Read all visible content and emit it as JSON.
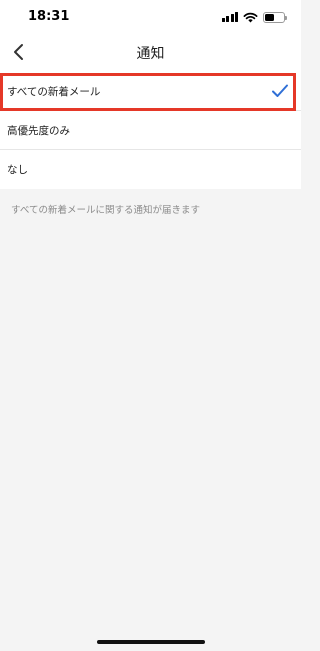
{
  "status_bar": {
    "time": "18:31",
    "battery_level": 0.45
  },
  "nav": {
    "title": "通知",
    "back_icon": "chevron-left-icon"
  },
  "options": [
    {
      "label": "すべての新着メール",
      "selected": true
    },
    {
      "label": "高優先度のみ",
      "selected": false
    },
    {
      "label": "なし",
      "selected": false
    }
  ],
  "footer_note": "すべての新着メールに関する通知が届きます",
  "colors": {
    "accent": "#2f6fd6",
    "highlight": "#e53828",
    "background": "#f4f4f4"
  }
}
